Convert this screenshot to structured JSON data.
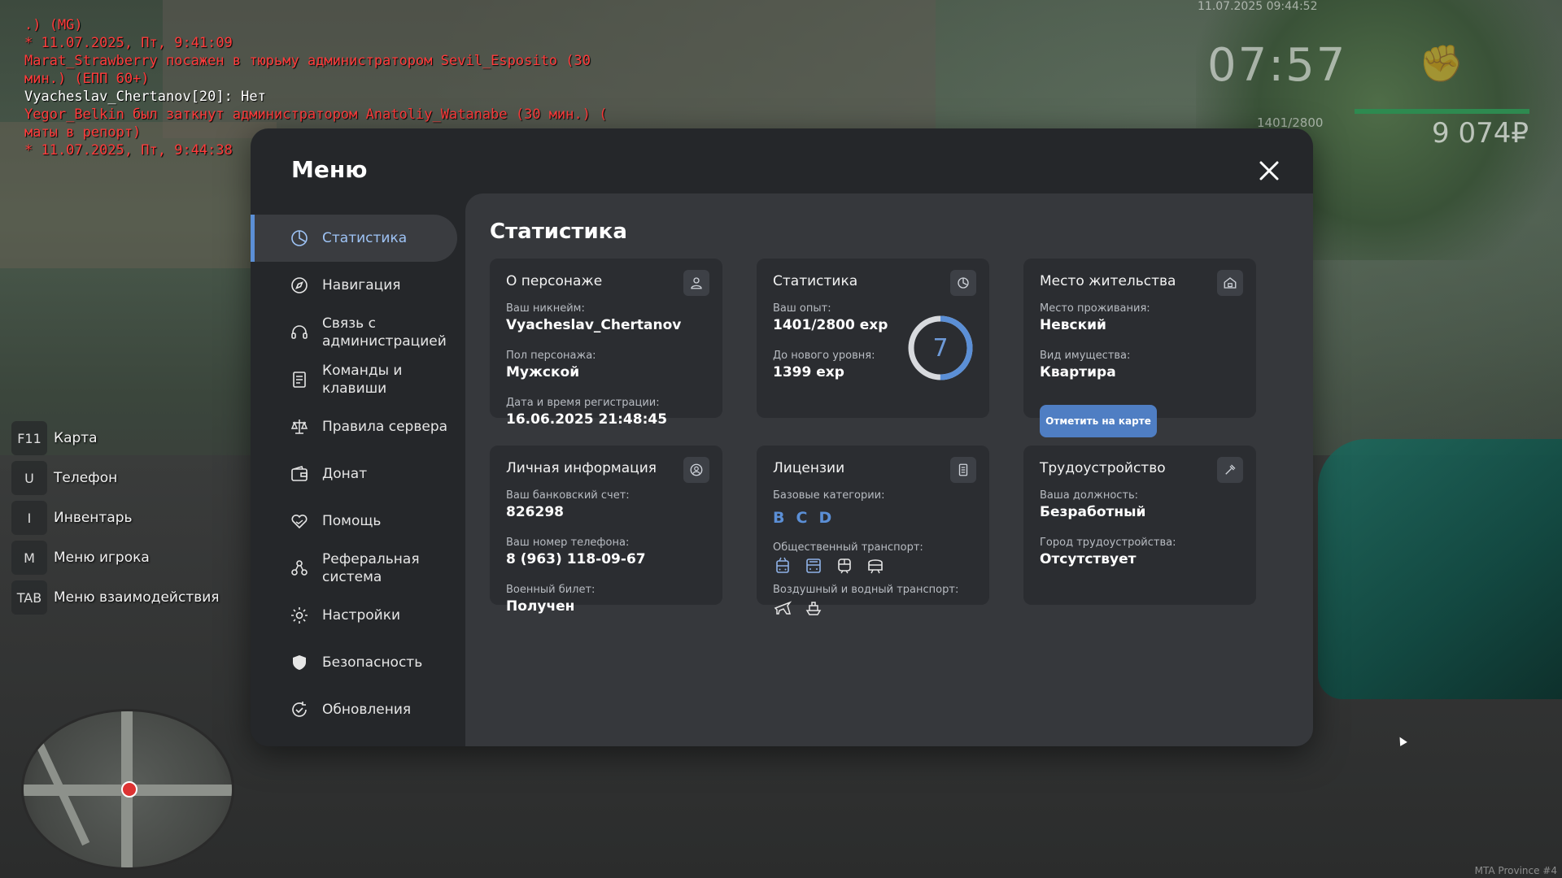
{
  "chat": [
    {
      "text": ".) (MG)",
      "color": "#ff3b3b"
    },
    {
      "text": "* 11.07.2025, Пт, 9:41:09",
      "color": "#ff3b3b"
    },
    {
      "text": "Marat_Strawberry посажен в тюрьму администратором Sevil_Esposito (30 мин.) (ЕПП 60+)",
      "color": "#ff3b3b"
    },
    {
      "text": "Vyacheslav_Chertanov[20]: Нет",
      "color": "#ffffff"
    },
    {
      "text": "Yegor_Belkin был заткнут администратором Anatoliy_Watanabe (30 мин.) ( маты в репорт)",
      "color": "#ff3b3b"
    },
    {
      "text": "* 11.07.2025, Пт, 9:44:38",
      "color": "#ff3b3b"
    }
  ],
  "hud": {
    "date": "11.07.2025 09:44:52",
    "time": "07:57",
    "exp": "1401/2800",
    "money": "9 074₽"
  },
  "keys": [
    {
      "key": "F11",
      "label": "Карта"
    },
    {
      "key": "U",
      "label": "Телефон"
    },
    {
      "key": "I",
      "label": "Инвентарь"
    },
    {
      "key": "M",
      "label": "Меню игрока"
    },
    {
      "key": "TAB",
      "label": "Меню взаимодействия"
    }
  ],
  "menu": {
    "title": "Меню",
    "nav": [
      {
        "label": "Статистика",
        "icon": "statistics-icon",
        "active": true
      },
      {
        "label": "Навигация",
        "icon": "compass-icon"
      },
      {
        "label": "Связь с администрацией",
        "icon": "headset-icon"
      },
      {
        "label": "Команды и клавиши",
        "icon": "document-icon"
      },
      {
        "label": "Правила сервера",
        "icon": "scales-icon"
      },
      {
        "label": "Донат",
        "icon": "wallet-icon"
      },
      {
        "label": "Помощь",
        "icon": "heart-hand-icon"
      },
      {
        "label": "Реферальная система",
        "icon": "referral-icon"
      },
      {
        "label": "Настройки",
        "icon": "gear-icon"
      },
      {
        "label": "Безопасность",
        "icon": "shield-icon"
      },
      {
        "label": "Обновления",
        "icon": "refresh-icon"
      }
    ],
    "content_title": "Статистика",
    "character": {
      "title": "О персонаже",
      "nick_label": "Ваш никнейм:",
      "nick": "Vyacheslav_Chertanov",
      "gender_label": "Пол персонажа:",
      "gender": "Мужской",
      "reg_label": "Дата и время регистрации:",
      "reg": "16.06.2025 21:48:45"
    },
    "stats": {
      "title": "Статистика",
      "exp_label": "Ваш опыт:",
      "exp": "1401/2800 exp",
      "next_label": "До нового уровня:",
      "next": "1399 exp",
      "level": "7",
      "progress": 0.5
    },
    "residence": {
      "title": "Место жительства",
      "place_label": "Место проживания:",
      "place": "Невский",
      "type_label": "Вид имущества:",
      "type": "Квартира",
      "button": "Отметить на карте"
    },
    "personal": {
      "title": "Личная информация",
      "bank_label": "Ваш банковский счет:",
      "bank": "826298",
      "phone_label": "Ваш номер телефона:",
      "phone": "8 (963) 118-09-67",
      "military_label": "Военный билет:",
      "military": "Получен"
    },
    "licenses": {
      "title": "Лицензии",
      "base_label": "Базовые категории:",
      "categories": [
        "B",
        "C",
        "D"
      ],
      "public_label": "Общественный транспорт:",
      "air_label": "Воздушный и водный транспорт:"
    },
    "employment": {
      "title": "Трудоустройство",
      "position_label": "Ваша должность:",
      "position": "Безработный",
      "city_label": "Город трудоустройства:",
      "city": "Отсутствует"
    }
  },
  "watermark": "MTA Province #4",
  "colors": {
    "accent": "#5b8fd6",
    "panel": "#25272a",
    "content": "#36383c",
    "card": "#2b2d31",
    "chat_red": "#ff3b3b"
  }
}
